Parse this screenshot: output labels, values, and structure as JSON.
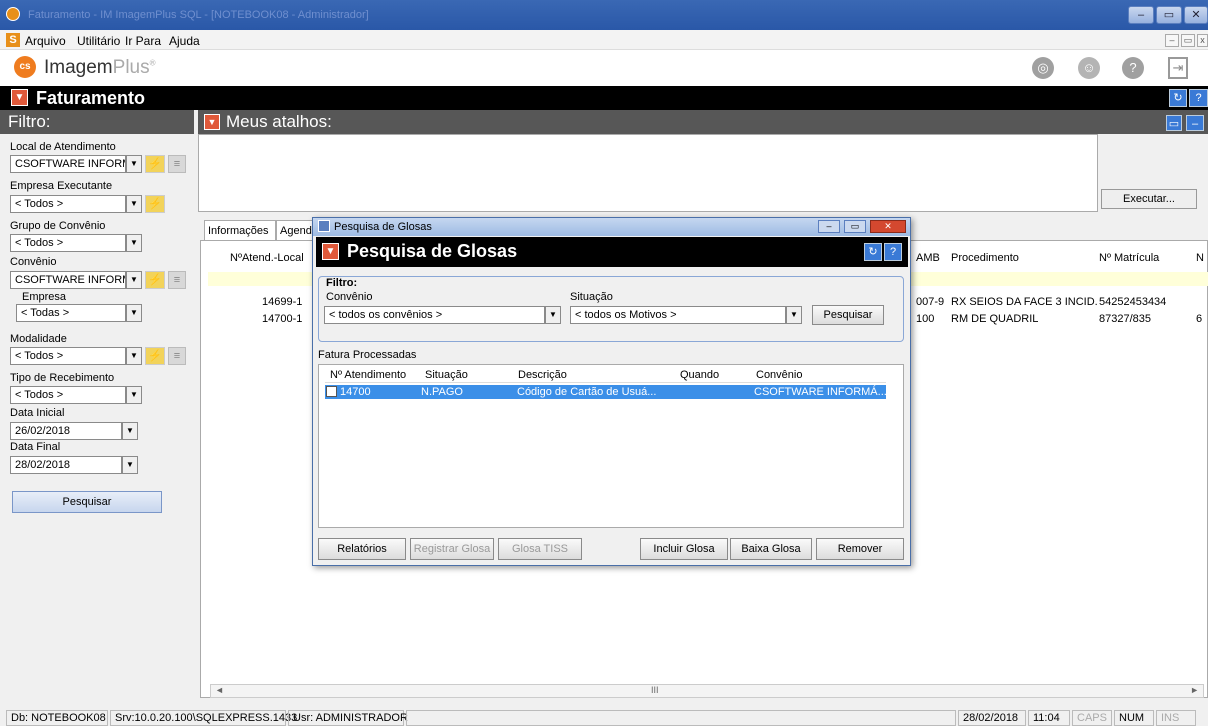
{
  "window": {
    "title": "Faturamento - IM ImagemPlus SQL - [NOTEBOOK08 - Administrador]"
  },
  "menu": {
    "app_icon": "S",
    "items": [
      "Arquivo",
      "Utilitário",
      "Ir Para",
      "Ajuda"
    ]
  },
  "brand": {
    "logo_mark": "cs",
    "name_main": "Imagem",
    "name_accent": "Plus",
    "reg": "®"
  },
  "section": {
    "title": "Faturamento"
  },
  "filter": {
    "title": "Filtro:",
    "local_label": "Local de Atendimento",
    "local_value": "CSOFTWARE INFORMÁ",
    "empresa_exec_label": "Empresa Executante",
    "empresa_exec_value": "< Todos >",
    "grupo_label": "Grupo de Convênio",
    "grupo_value": "< Todos >",
    "convenio_label": "Convênio",
    "convenio_value": "CSOFTWARE INFORMÁ",
    "empresa_label": "Empresa",
    "empresa_value": "< Todas >",
    "modalidade_label": "Modalidade",
    "modalidade_value": "< Todos >",
    "tipo_label": "Tipo de Recebimento",
    "tipo_value": "< Todos >",
    "data_ini_label": "Data Inicial",
    "data_ini_value": "26/02/2018",
    "data_fim_label": "Data Final",
    "data_fim_value": "28/02/2018",
    "search_button": "Pesquisar"
  },
  "atalhos": {
    "title": "Meus atalhos:",
    "execute_button": "Executar..."
  },
  "tabs": [
    "Informações",
    "Agenda"
  ],
  "grid": {
    "headers": {
      "atend": "NºAtend.-Local",
      "amb": "AMB",
      "procedimento": "Procedimento",
      "matricula": "Nº Matrícula",
      "extra": "N"
    },
    "rows": [
      {
        "atend": "14699-1",
        "amb": "007-9",
        "procedimento": "RX SEIOS DA FACE 3 INCID.",
        "matricula": "54252453434",
        "extra": ""
      },
      {
        "atend": "14700-1",
        "amb": "100",
        "procedimento": "RM DE QUADRIL",
        "matricula": "87327/835",
        "extra": "6"
      }
    ],
    "scroll_grip": "III"
  },
  "status": {
    "db": "Db: NOTEBOOK08",
    "srv": "Srv:10.0.20.100\\SQLEXPRESS.1433",
    "usr": "Usr: ADMINISTRADOR",
    "date": "28/02/2018",
    "time": "11:04",
    "caps": "CAPS",
    "num": "NUM",
    "ins": "INS"
  },
  "dialog": {
    "window_title": "Pesquisa de Glosas",
    "header_title": "Pesquisa de Glosas",
    "filter_legend": "Filtro:",
    "convenio_label": "Convênio",
    "convenio_value": "< todos os convênios >",
    "situacao_label": "Situação",
    "situacao_value": "< todos os Motivos >",
    "search_button": "Pesquisar",
    "list_title": "Fatura Processadas",
    "columns": [
      "Nº Atendimento",
      "Situação",
      "Descrição",
      "Quando",
      "Convênio"
    ],
    "rows": [
      {
        "atend": "14700",
        "situacao": "N.PAGO",
        "descricao": "Código de Cartão de Usuá...",
        "quando": "",
        "convenio": "CSOFTWARE INFORMÁ..."
      }
    ],
    "buttons": {
      "relatorios": "Relatórios",
      "registrar": "Registrar Glosa",
      "tiss": "Glosa TISS",
      "incluir": "Incluir Glosa",
      "baixa": "Baixa Glosa",
      "remover": "Remover"
    }
  }
}
